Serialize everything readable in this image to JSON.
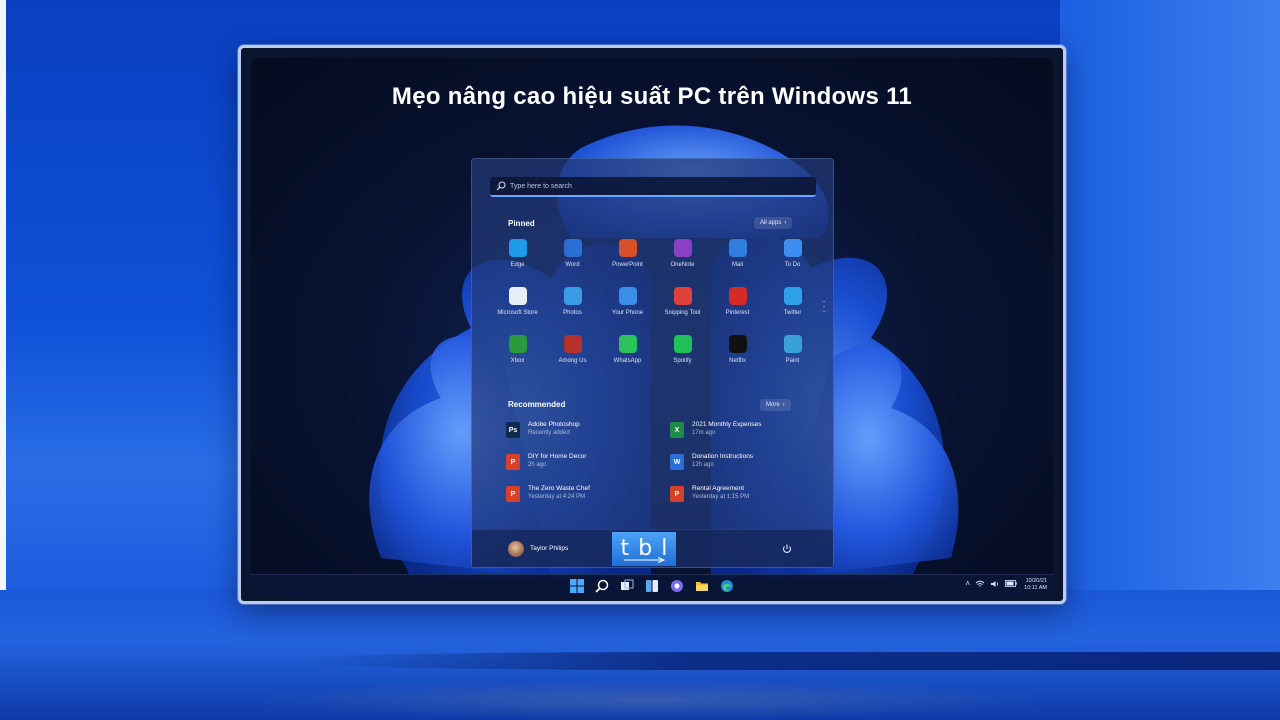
{
  "headline": "Mẹo nâng cao hiệu suất PC trên Windows 11",
  "start_menu": {
    "search_placeholder": "Type here to search",
    "pinned_title": "Pinned",
    "all_apps_label": "All apps",
    "pinned_apps": [
      {
        "label": "Edge",
        "icon": "edge-icon",
        "color": "#1e9be8"
      },
      {
        "label": "Word",
        "icon": "word-icon",
        "color": "#2b6fd6"
      },
      {
        "label": "PowerPoint",
        "icon": "powerpoint-icon",
        "color": "#d8502b"
      },
      {
        "label": "OneNote",
        "icon": "onenote-icon",
        "color": "#8a3fc7"
      },
      {
        "label": "Mail",
        "icon": "mail-icon",
        "color": "#2f7ee0"
      },
      {
        "label": "To Do",
        "icon": "todo-icon",
        "color": "#3d8df0"
      },
      {
        "label": "Microsoft Store",
        "icon": "store-icon",
        "color": "#e8eef8"
      },
      {
        "label": "Photos",
        "icon": "photos-icon",
        "color": "#3a9ce6"
      },
      {
        "label": "Your Phone",
        "icon": "phone-icon",
        "color": "#3a8ee8"
      },
      {
        "label": "Snipping Tool",
        "icon": "snipping-icon",
        "color": "#e0403a"
      },
      {
        "label": "Pinterest",
        "icon": "pinterest-icon",
        "color": "#d52a2a"
      },
      {
        "label": "Twitter",
        "icon": "twitter-icon",
        "color": "#2fa0ea"
      },
      {
        "label": "Xbox",
        "icon": "xbox-icon",
        "color": "#2a9a3a"
      },
      {
        "label": "Among Us",
        "icon": "among-us-icon",
        "color": "#b8302a"
      },
      {
        "label": "WhatsApp",
        "icon": "whatsapp-icon",
        "color": "#2cc25a"
      },
      {
        "label": "Spotify",
        "icon": "spotify-icon",
        "color": "#1fc05a"
      },
      {
        "label": "Netflix",
        "icon": "netflix-icon",
        "color": "#111111"
      },
      {
        "label": "Paint",
        "icon": "paint-icon",
        "color": "#3aa0d8"
      }
    ],
    "recommended_title": "Recommended",
    "more_label": "More",
    "recommended": [
      {
        "name": "Adobe Photoshop",
        "time": "Recently added",
        "icon": "photoshop-icon",
        "color": "#0f2a4a",
        "glyph": "Ps"
      },
      {
        "name": "2021 Monthly Expenses",
        "time": "17m ago",
        "icon": "excel-file-icon",
        "color": "#1f8a4a",
        "glyph": "X"
      },
      {
        "name": "DIY for Home Decor",
        "time": "2h ago",
        "icon": "pdf-file-icon",
        "color": "#d8402a",
        "glyph": "P"
      },
      {
        "name": "Donation Instructions",
        "time": "12h ago",
        "icon": "word-file-icon",
        "color": "#2b6fd6",
        "glyph": "W"
      },
      {
        "name": "The Zero Waste Chef",
        "time": "Yesterday at 4:24 PM",
        "icon": "pdf-file-icon",
        "color": "#d8402a",
        "glyph": "P"
      },
      {
        "name": "Rental Agreement",
        "time": "Yesterday at 1:15 PM",
        "icon": "pdf-file-icon",
        "color": "#d8402a",
        "glyph": "P"
      }
    ],
    "user_name": "Taylor Philips"
  },
  "logo": {
    "letters": [
      "t",
      "b",
      "l"
    ]
  },
  "taskbar": {
    "clock_date": "10/20/21",
    "clock_time": "10:11 AM"
  }
}
